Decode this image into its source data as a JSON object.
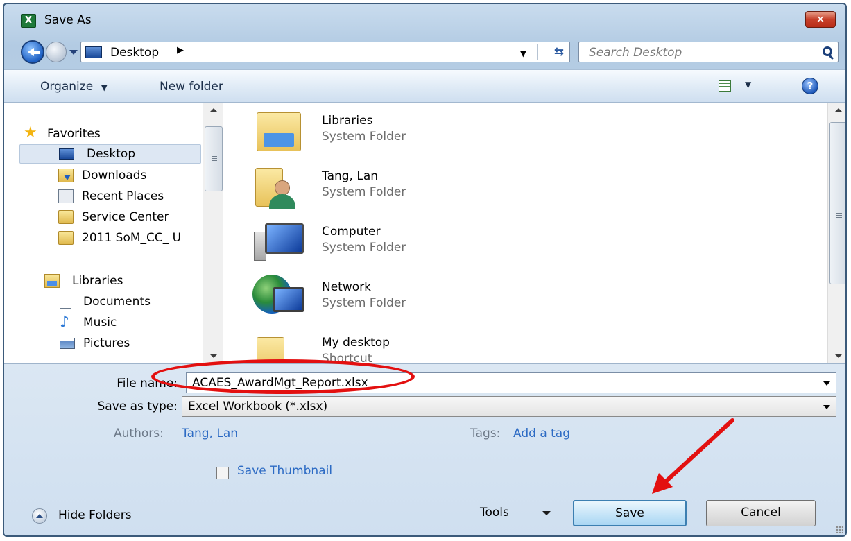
{
  "window": {
    "title": "Save As"
  },
  "address_bar": {
    "location": "Desktop"
  },
  "search": {
    "placeholder": "Search Desktop"
  },
  "toolbar": {
    "organize_label": "Organize",
    "new_folder_label": "New folder"
  },
  "nav_pane": {
    "favorites_header": "Favorites",
    "favorites": [
      {
        "label": "Desktop",
        "icon": "desktop-icon",
        "selected": true
      },
      {
        "label": "Downloads",
        "icon": "downloads-icon"
      },
      {
        "label": "Recent Places",
        "icon": "recent-places-icon"
      },
      {
        "label": "Service Center",
        "icon": "folder-icon"
      },
      {
        "label": "2011 SoM_CC_ U",
        "icon": "folder-icon"
      }
    ],
    "libraries_header": "Libraries",
    "libraries": [
      {
        "label": "Documents",
        "icon": "documents-icon"
      },
      {
        "label": "Music",
        "icon": "music-icon"
      },
      {
        "label": "Pictures",
        "icon": "pictures-icon"
      }
    ]
  },
  "files": [
    {
      "name": "Libraries",
      "type": "System Folder",
      "icon": "libraries-folder-icon"
    },
    {
      "name": "Tang, Lan",
      "type": "System Folder",
      "icon": "user-folder-icon"
    },
    {
      "name": "Computer",
      "type": "System Folder",
      "icon": "computer-icon"
    },
    {
      "name": "Network",
      "type": "System Folder",
      "icon": "network-icon"
    },
    {
      "name": "My desktop",
      "type": "Shortcut",
      "icon": "folder-icon"
    }
  ],
  "details": {
    "file_name_label": "File name:",
    "file_name_value": "ACAES_AwardMgt_Report.xlsx",
    "save_type_label": "Save as type:",
    "save_type_value": "Excel Workbook (*.xlsx)",
    "authors_label": "Authors:",
    "authors_value": "Tang, Lan",
    "tags_label": "Tags:",
    "tags_value": "Add a tag",
    "save_thumbnail_label": "Save Thumbnail",
    "save_thumbnail_checked": false
  },
  "footer": {
    "hide_folders_label": "Hide Folders",
    "tools_label": "Tools",
    "save_label": "Save",
    "cancel_label": "Cancel"
  },
  "colors": {
    "annotation": "#e31010",
    "link": "#2d6bc4",
    "title_bar": "#b3cbe3"
  }
}
